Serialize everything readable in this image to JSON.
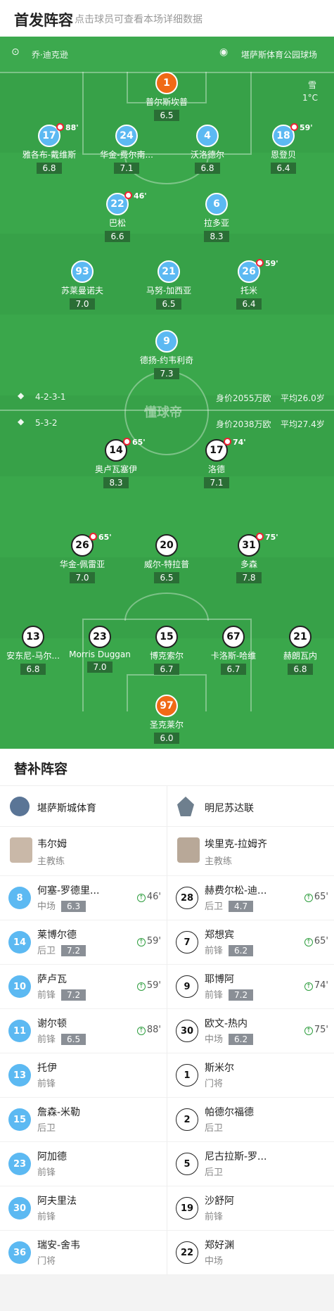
{
  "header": {
    "title": "首发阵容",
    "subtitle": "点击球员可查看本场详细数据"
  },
  "match": {
    "referee": "乔·迪克逊",
    "stadium": "堪萨斯体育公园球场",
    "weather": "雪",
    "temp": "1°C"
  },
  "home": {
    "formation": "4-2-3-1",
    "value": "身价2055万欧",
    "avg_age": "平均26.0岁"
  },
  "away": {
    "formation": "5-3-2",
    "value": "身价2038万欧",
    "avg_age": "平均27.4岁"
  },
  "home_players": [
    {
      "num": "1",
      "name": "普尔斯坎普",
      "rating": "6.5",
      "color": "orange",
      "ev": ""
    },
    {
      "num": "17",
      "name": "雅各布-戴维斯",
      "rating": "6.8",
      "color": "blue",
      "ev": "88'"
    },
    {
      "num": "24",
      "name": "华金-费尔南...",
      "rating": "7.1",
      "color": "blue",
      "ev": ""
    },
    {
      "num": "4",
      "name": "沃洛德尔",
      "rating": "6.8",
      "color": "blue",
      "ev": ""
    },
    {
      "num": "18",
      "name": "恩登贝",
      "rating": "6.4",
      "color": "blue",
      "ev": "59'"
    },
    {
      "num": "22",
      "name": "巴松",
      "rating": "6.6",
      "color": "blue",
      "ev": "46'"
    },
    {
      "num": "6",
      "name": "拉多亚",
      "rating": "8.3",
      "color": "blue",
      "ev": ""
    },
    {
      "num": "93",
      "name": "苏莱曼诺夫",
      "rating": "7.0",
      "color": "blue",
      "ev": ""
    },
    {
      "num": "21",
      "name": "马努-加西亚",
      "rating": "6.5",
      "color": "blue",
      "ev": ""
    },
    {
      "num": "26",
      "name": "托米",
      "rating": "6.4",
      "color": "blue",
      "ev": "59'"
    },
    {
      "num": "9",
      "name": "德扬-约韦利奇",
      "rating": "7.3",
      "color": "blue",
      "ev": ""
    }
  ],
  "away_players": [
    {
      "num": "14",
      "name": "奥卢瓦塞伊",
      "rating": "8.3",
      "color": "white",
      "ev": "65'"
    },
    {
      "num": "17",
      "name": "洛德",
      "rating": "7.1",
      "color": "white",
      "ev": "74'"
    },
    {
      "num": "26",
      "name": "华金-佩雷亚",
      "rating": "7.0",
      "color": "white",
      "ev": "65'"
    },
    {
      "num": "20",
      "name": "威尔-特拉普",
      "rating": "6.5",
      "color": "white",
      "ev": ""
    },
    {
      "num": "31",
      "name": "多森",
      "rating": "7.8",
      "color": "white",
      "ev": "75'"
    },
    {
      "num": "13",
      "name": "安东尼-马尔...",
      "rating": "6.8",
      "color": "white",
      "ev": ""
    },
    {
      "num": "23",
      "name": "Morris Duggan",
      "rating": "7.0",
      "color": "white",
      "ev": ""
    },
    {
      "num": "15",
      "name": "博克索尔",
      "rating": "6.7",
      "color": "white",
      "ev": ""
    },
    {
      "num": "67",
      "name": "卡洛斯-哈维",
      "rating": "6.7",
      "color": "white",
      "ev": ""
    },
    {
      "num": "21",
      "name": "赫朗瓦内",
      "rating": "6.8",
      "color": "white",
      "ev": ""
    },
    {
      "num": "97",
      "name": "圣克莱尔",
      "rating": "6.0",
      "color": "orange",
      "ev": ""
    }
  ],
  "subs": {
    "title": "替补阵容",
    "home_team": "堪萨斯城体育",
    "away_team": "明尼苏达联",
    "home_coach": {
      "name": "韦尔姆",
      "role": "主教练"
    },
    "away_coach": {
      "name": "埃里克-拉姆齐",
      "role": "主教练"
    },
    "home": [
      {
        "num": "8",
        "name": "何塞-罗德里...",
        "pos": "中场",
        "rating": "6.3",
        "min": "46'"
      },
      {
        "num": "14",
        "name": "莱博尔德",
        "pos": "后卫",
        "rating": "7.2",
        "min": "59'"
      },
      {
        "num": "10",
        "name": "萨卢瓦",
        "pos": "前锋",
        "rating": "7.2",
        "min": "59'"
      },
      {
        "num": "11",
        "name": "谢尔顿",
        "pos": "前锋",
        "rating": "6.5",
        "min": "88'"
      },
      {
        "num": "13",
        "name": "托伊",
        "pos": "前锋",
        "rating": "",
        "min": ""
      },
      {
        "num": "15",
        "name": "詹森-米勒",
        "pos": "后卫",
        "rating": "",
        "min": ""
      },
      {
        "num": "23",
        "name": "阿加德",
        "pos": "前锋",
        "rating": "",
        "min": ""
      },
      {
        "num": "30",
        "name": "阿夫里法",
        "pos": "前锋",
        "rating": "",
        "min": ""
      },
      {
        "num": "36",
        "name": "瑞安-舍韦",
        "pos": "门将",
        "rating": "",
        "min": ""
      }
    ],
    "away": [
      {
        "num": "28",
        "name": "赫费尔松-迪...",
        "pos": "后卫",
        "rating": "4.7",
        "min": "65'"
      },
      {
        "num": "7",
        "name": "郑想宾",
        "pos": "前锋",
        "rating": "6.2",
        "min": "65'"
      },
      {
        "num": "9",
        "name": "耶博阿",
        "pos": "前锋",
        "rating": "7.2",
        "min": "74'"
      },
      {
        "num": "30",
        "name": "欧文-热内",
        "pos": "中场",
        "rating": "6.2",
        "min": "75'"
      },
      {
        "num": "1",
        "name": "斯米尔",
        "pos": "门将",
        "rating": "",
        "min": ""
      },
      {
        "num": "2",
        "name": "帕德尔福德",
        "pos": "后卫",
        "rating": "",
        "min": ""
      },
      {
        "num": "5",
        "name": "尼古拉斯-罗...",
        "pos": "后卫",
        "rating": "",
        "min": ""
      },
      {
        "num": "19",
        "name": "沙舒阿",
        "pos": "前锋",
        "rating": "",
        "min": ""
      },
      {
        "num": "22",
        "name": "郑好渊",
        "pos": "中场",
        "rating": "",
        "min": ""
      }
    ]
  },
  "watermark": "懂球帝"
}
